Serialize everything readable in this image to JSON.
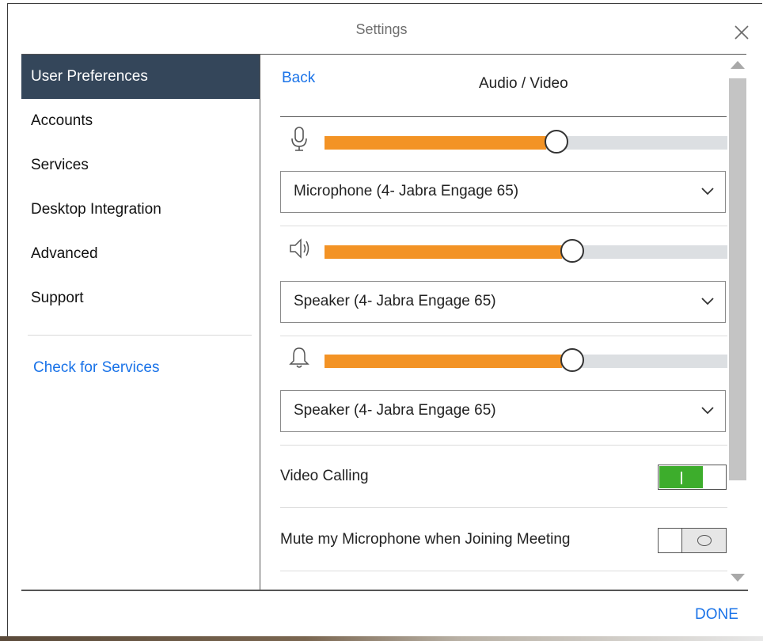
{
  "dialog": {
    "title": "Settings",
    "done_label": "DONE"
  },
  "sidebar": {
    "items": [
      {
        "label": "User Preferences",
        "active": true
      },
      {
        "label": "Accounts"
      },
      {
        "label": "Services"
      },
      {
        "label": "Desktop Integration"
      },
      {
        "label": "Advanced"
      },
      {
        "label": "Support"
      }
    ],
    "link_label": "Check for Services"
  },
  "panel": {
    "back_label": "Back",
    "title": "Audio / Video",
    "microphone": {
      "icon": "microphone-icon",
      "level": 0.55,
      "device": "Microphone (4- Jabra Engage 65)"
    },
    "speaker": {
      "icon": "speaker-icon",
      "level": 0.59,
      "device": "Speaker (4- Jabra Engage 65)"
    },
    "ringer": {
      "icon": "bell-icon",
      "level": 0.59,
      "device": "Speaker (4- Jabra Engage 65)"
    },
    "video_calling": {
      "label": "Video Calling",
      "enabled": true
    },
    "mute_on_join": {
      "label": "Mute my Microphone when Joining Meeting",
      "enabled": false
    }
  },
  "colors": {
    "accent": "#1a73e8",
    "slider_fill": "#f39325",
    "toggle_on": "#3dad2c",
    "sidebar_active": "#34465a"
  }
}
